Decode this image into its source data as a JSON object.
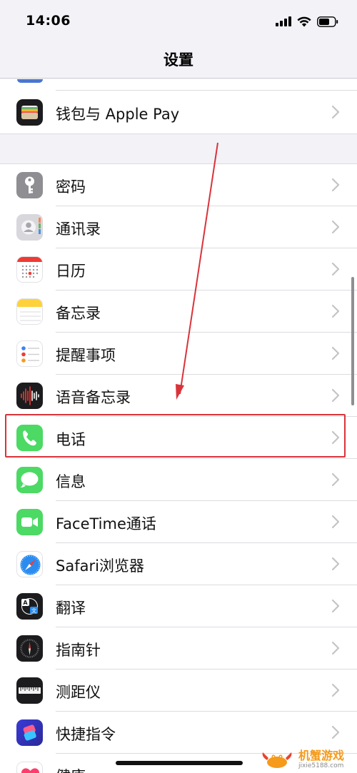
{
  "status_bar": {
    "time": "14:06"
  },
  "nav": {
    "title": "设置"
  },
  "rows": [
    {
      "label": "钱包与 Apple Pay",
      "icon": "wallet-icon",
      "color": "#1c1c1e"
    },
    {
      "label": "密码",
      "icon": "key-icon",
      "color": "#8e8e93"
    },
    {
      "label": "通讯录",
      "icon": "contacts-icon",
      "color": "#d8d8dc"
    },
    {
      "label": "日历",
      "icon": "calendar-icon",
      "color": "#ffffff"
    },
    {
      "label": "备忘录",
      "icon": "notes-icon",
      "color": "#ffd23c"
    },
    {
      "label": "提醒事项",
      "icon": "reminders-icon",
      "color": "#ffffff"
    },
    {
      "label": "语音备忘录",
      "icon": "voice-memos-icon",
      "color": "#1c1c1e"
    },
    {
      "label": "电话",
      "icon": "phone-icon",
      "color": "#4cd964"
    },
    {
      "label": "信息",
      "icon": "messages-icon",
      "color": "#4cd964"
    },
    {
      "label": "FaceTime通话",
      "icon": "facetime-icon",
      "color": "#4cd964"
    },
    {
      "label": "Safari浏览器",
      "icon": "safari-icon",
      "color": "#ffffff"
    },
    {
      "label": "翻译",
      "icon": "translate-icon",
      "color": "#1c1c1e"
    },
    {
      "label": "指南针",
      "icon": "compass-icon",
      "color": "#1c1c1e"
    },
    {
      "label": "测距仪",
      "icon": "measure-icon",
      "color": "#1c1c1e"
    },
    {
      "label": "快捷指令",
      "icon": "shortcuts-icon",
      "color": "#3a3ad6"
    },
    {
      "label": "健康",
      "icon": "health-icon",
      "color": "#ffffff"
    }
  ],
  "highlighted_row": "电话",
  "annotation": {
    "color": "#d9333a"
  },
  "watermark": {
    "text": "机蟹游戏",
    "url": "jixie5188.com"
  }
}
